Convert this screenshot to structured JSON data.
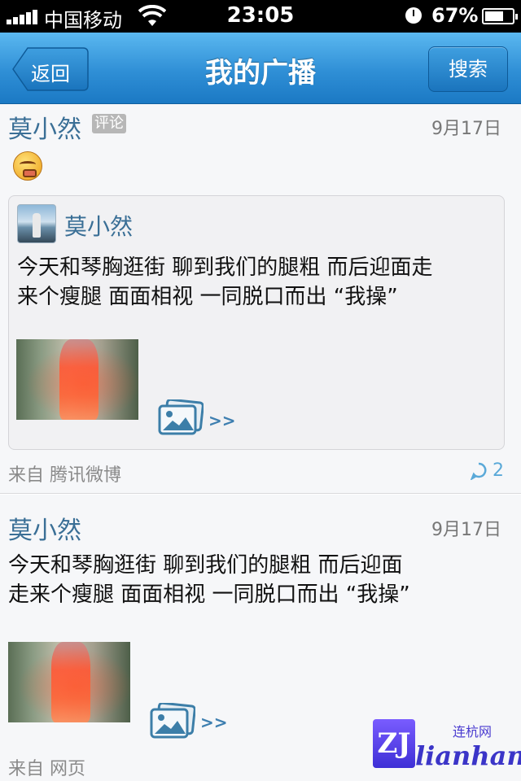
{
  "status_bar": {
    "carrier": "中国移动",
    "time": "23:05",
    "battery": "67%",
    "icons": [
      "signal-icon",
      "wifi-icon",
      "alarm-icon",
      "battery-icon"
    ]
  },
  "nav": {
    "back_label": "返回",
    "title": "我的广播",
    "search_label": "搜索",
    "colors": {
      "bar": "#2f8fd6",
      "bar_light": "#5bb8f0"
    }
  },
  "posts": [
    {
      "author": "莫小然",
      "badge": "评论",
      "date": "9月17日",
      "emoji": "smiley-face-icon",
      "quoted": {
        "author": "莫小然",
        "text_line1": "今天和琴胸逛街 聊到我们的腿粗 而后迎面走",
        "text_line2": "来个瘦腿 面面相视 一同脱口而出 “我操”",
        "more": ">>"
      },
      "source": "来自 腾讯微博",
      "comment_count": "2"
    },
    {
      "author": "莫小然",
      "date": "9月17日",
      "text_line1": "今天和琴胸逛街 聊到我们的腿粗 而后迎面",
      "text_line2": "走来个瘦腿 面面相视 一同脱口而出 “我操”",
      "more": ">>",
      "source": "来自 网页"
    }
  ],
  "watermark": {
    "logo": "ZJ",
    "small": "连杭网",
    "big": "lianhang"
  },
  "colors": {
    "name": "#3a6f96",
    "accent": "#3e7fb0",
    "background": "#f6f7f9"
  }
}
